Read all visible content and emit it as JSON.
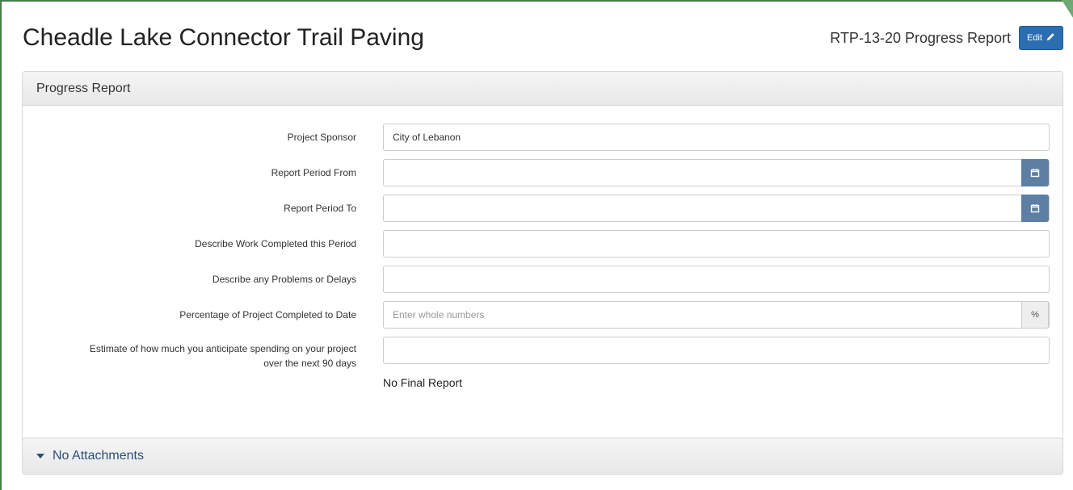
{
  "header": {
    "title": "Cheadle Lake Connector Trail Paving",
    "report_ref": "RTP-13-20  Progress Report",
    "edit_label": "Edit"
  },
  "progress_panel": {
    "heading": "Progress Report",
    "fields": [
      {
        "label": "Project Sponsor",
        "value": "City of Lebanon"
      },
      {
        "label": "Report Period From",
        "value": ""
      },
      {
        "label": "Report Period To",
        "value": ""
      },
      {
        "label": "Describe Work Completed this Period",
        "value": ""
      },
      {
        "label": "Describe any Problems or Delays",
        "value": ""
      },
      {
        "label": "Percentage of Project Completed to Date",
        "placeholder": "Enter whole numbers",
        "addon": "%"
      },
      {
        "label_line1": "Estimate of how much you anticipate spending on your project",
        "label_line2": "over the next 90 days",
        "value": ""
      }
    ],
    "final_report": "No Final Report"
  },
  "attachments": {
    "label": "No Attachments"
  },
  "icons": {
    "edit": "pencil-icon",
    "date": "calendar-icon",
    "expand": "caret-down-icon"
  },
  "colors": {
    "primary": "#2a6db0",
    "calendar_addon": "#5c7fa3",
    "frame": "#4a7d4a"
  }
}
